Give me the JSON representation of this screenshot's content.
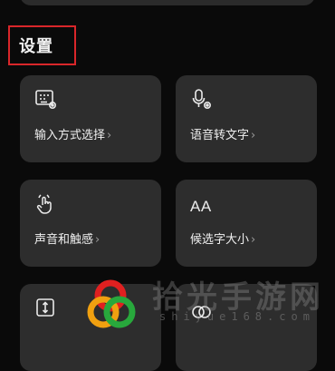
{
  "section": {
    "title": "设置"
  },
  "tiles": [
    {
      "label": "输入方式选择",
      "icon": "keyboard-gear-icon"
    },
    {
      "label": "语音转文字",
      "icon": "microphone-gear-icon"
    },
    {
      "label": "声音和触感",
      "icon": "touch-vibrate-icon"
    },
    {
      "label": "候选字大小",
      "icon": "font-size-icon",
      "icon_text": "AA"
    },
    {
      "label": "",
      "icon": "vertical-resize-icon"
    },
    {
      "label": "",
      "icon": "overlap-circles-icon"
    }
  ],
  "chevron": "›",
  "watermark": {
    "text": "拾光手游网",
    "sub": "shiyue168.com"
  },
  "colors": {
    "background": "#0a0a0a",
    "tile": "#2d2d2d",
    "highlight": "#d9262a"
  }
}
